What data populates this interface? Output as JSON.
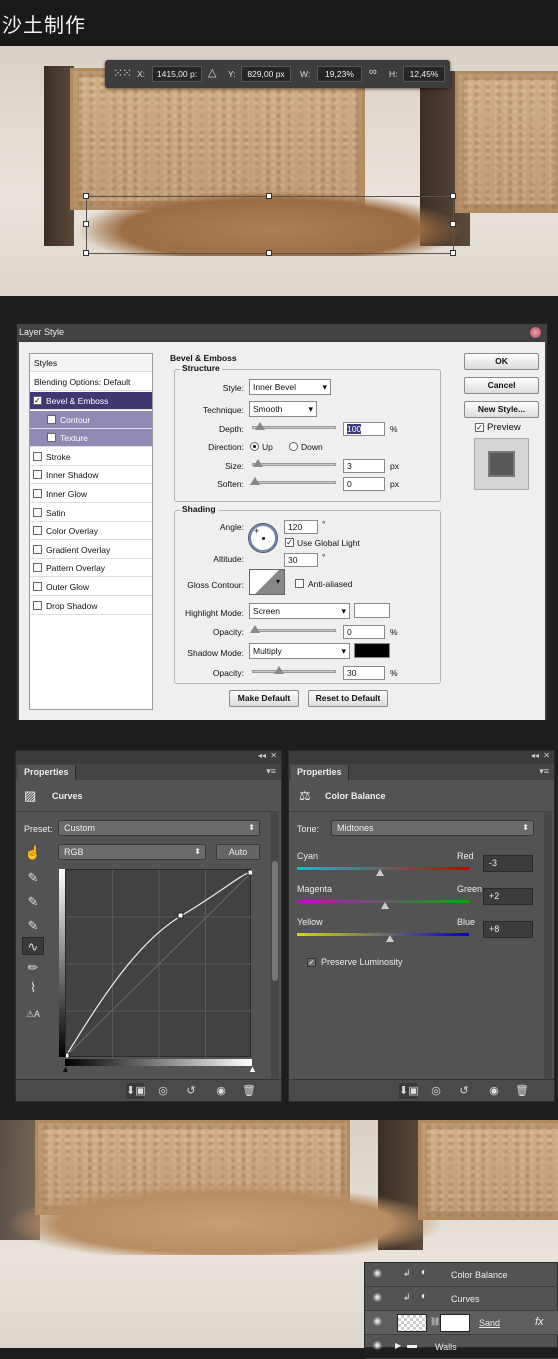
{
  "page_title": "沙土制作",
  "transform_bar": {
    "x_label": "X:",
    "x_value": "1415,00 p:",
    "y_label": "Y:",
    "y_value": "829,00 px",
    "w_label": "W:",
    "w_value": "19,23%",
    "h_label": "H:",
    "h_value": "12,45%"
  },
  "layer_style": {
    "title": "Layer Style",
    "styles_header": "Styles",
    "blending_options": "Blending Options: Default",
    "items": [
      "Bevel & Emboss",
      "Contour",
      "Texture",
      "Stroke",
      "Inner Shadow",
      "Inner Glow",
      "Satin",
      "Color Overlay",
      "Gradient Overlay",
      "Pattern Overlay",
      "Outer Glow",
      "Drop Shadow"
    ],
    "checked": [
      true,
      false,
      false,
      false,
      false,
      false,
      false,
      false,
      false,
      false,
      false,
      false
    ],
    "section_title": "Bevel & Emboss",
    "structure": {
      "title": "Structure",
      "style_label": "Style:",
      "style_value": "Inner Bevel",
      "technique_label": "Technique:",
      "technique_value": "Smooth",
      "depth_label": "Depth:",
      "depth_value": "100",
      "depth_unit": "%",
      "direction_label": "Direction:",
      "direction_up": "Up",
      "direction_down": "Down",
      "size_label": "Size:",
      "size_value": "3",
      "size_unit": "px",
      "soften_label": "Soften:",
      "soften_value": "0",
      "soften_unit": "px"
    },
    "shading": {
      "title": "Shading",
      "angle_label": "Angle:",
      "angle_value": "120",
      "angle_unit": "°",
      "use_global_light": "Use Global Light",
      "altitude_label": "Altitude:",
      "altitude_value": "30",
      "altitude_unit": "°",
      "gloss_contour_label": "Gloss Contour:",
      "anti_aliased": "Anti-aliased",
      "highlight_mode_label": "Highlight Mode:",
      "highlight_mode_value": "Screen",
      "highlight_color": "#ffffff",
      "highlight_opacity_label": "Opacity:",
      "highlight_opacity_value": "0",
      "highlight_opacity_unit": "%",
      "shadow_mode_label": "Shadow Mode:",
      "shadow_mode_value": "Multiply",
      "shadow_color": "#000000",
      "shadow_opacity_label": "Opacity:",
      "shadow_opacity_value": "30",
      "shadow_opacity_unit": "%"
    },
    "make_default": "Make Default",
    "reset_default": "Reset to Default",
    "ok": "OK",
    "cancel": "Cancel",
    "new_style": "New Style...",
    "preview": "Preview"
  },
  "curves_panel": {
    "tab": "Properties",
    "title": "Curves",
    "preset_label": "Preset:",
    "preset_value": "Custom",
    "channel_value": "RGB",
    "auto_button": "Auto",
    "collapse": "◂◂",
    "close": "✕"
  },
  "color_balance_panel": {
    "tab": "Properties",
    "title": "Color Balance",
    "tone_label": "Tone:",
    "tone_value": "Midtones",
    "sliders": [
      {
        "left": "Cyan",
        "right": "Red",
        "value": "-3",
        "level": -3
      },
      {
        "left": "Magenta",
        "right": "Green",
        "value": "+2",
        "level": 2
      },
      {
        "left": "Yellow",
        "right": "Blue",
        "value": "+8",
        "level": 8
      }
    ],
    "preserve_luminosity": "Preserve Luminosity",
    "collapse": "◂◂",
    "close": "✕"
  },
  "layers": [
    {
      "name": "Color Balance"
    },
    {
      "name": "Curves"
    },
    {
      "name": "Sand",
      "fx": "fx"
    },
    {
      "name": "Walls"
    }
  ]
}
